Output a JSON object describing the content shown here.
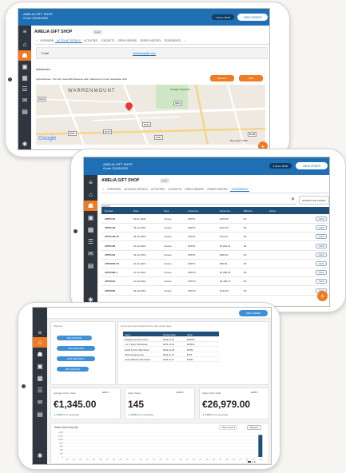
{
  "brand": {
    "orange": "#f07b22",
    "blue": "#1f6fb5",
    "navy": "#2f3640"
  },
  "shop": {
    "name": "AMELIA GIFT SHOP",
    "subtitle": "Order 23/03/2020",
    "badge": "Lost",
    "items_badge": "4 Items / €0.00",
    "view_order": "VIEW ORDER"
  },
  "s1": {
    "tabs": [
      "OVERVIEW",
      "ACCOUNT DETAILS",
      "ACTIVITIES",
      "CONTACTS",
      "OPEN ORDERS",
      "ORDER HISTORY",
      "STATEMENTS"
    ],
    "email_label": "E-Mail",
    "email_value": "ameliashop@ie.com",
    "addresses_label": "Addresses",
    "address": "Aghnaclifnane, The Hill, Greenhills Business park, Newtown Inn road, Stepaside, D/W",
    "btn_select": "SELECT",
    "btn_add": "ADD",
    "map": {
      "area": "WARRENMOUNT",
      "park": "Iveagh Gardens",
      "roads": [
        "R110",
        "R811",
        "R137",
        "R114",
        "R111",
        "R111",
        "R138"
      ],
      "google": "Google",
      "credit": "Map data ©2020"
    }
  },
  "s2": {
    "tabs": [
      "OVERVIEW",
      "ACCOUNT DETAILS",
      "ACTIVITIES",
      "CONTACTS",
      "OPEN ORDERS",
      "ORDER HISTORY",
      "STATEMENTS"
    ],
    "search_placeholder": "Search",
    "download": "DOWNLOAD LATEST",
    "columns": [
      "Number",
      "Date",
      "Type",
      "Customer...",
      "Gross Am...",
      "Balance",
      "Action"
    ],
    "rows": [
      [
        "APPX161",
        "20-01-2020",
        "Invoice",
        "APPX1",
        "€158.05",
        "€0"
      ],
      [
        "APPX148",
        "18-12-2019",
        "Invoice",
        "APPX1",
        "€122.70",
        "€0"
      ],
      [
        "APPX148-18",
        "18-12-2019",
        "Invoice",
        "APPX1",
        "€111.61",
        "€0"
      ],
      [
        "APPX136",
        "13-12-2019",
        "Invoice",
        "APPX1",
        "€3,861.44",
        "€0"
      ],
      [
        "APPX118",
        "02-12-2019",
        "Invoice",
        "APPX1",
        "€282.61",
        "€0"
      ],
      [
        "APPX876-T6",
        "19-11-2019",
        "Invoice",
        "APPX1",
        "€58.93",
        "€0"
      ],
      [
        "APPX098-1",
        "07-11-2019",
        "Invoice",
        "APPX4",
        "€1,096.60",
        "€0"
      ],
      [
        "APPX944",
        "10-10-2019",
        "Invoice",
        "APPX4",
        "€1,456.70",
        "€0"
      ],
      [
        "APPX830",
        "04-10-2019",
        "Invoice",
        "APPX4",
        "€132.03",
        "€0"
      ]
    ],
    "view": "VIEW"
  },
  "s3": {
    "new_order": "NEW ORDER",
    "payment_label": "Payment",
    "payment_buttons": [
      "30% (€27100)",
      "60% (€6723%)",
      "60% (€15100%)",
      "90% (€23216)"
    ],
    "opp_label": "Upcoming opportunities for the next seven days",
    "opp_columns": [
      "Name",
      "Closing Date",
      "Value"
    ],
    "opp_rows": [
      [
        "Bridgestone Electronics",
        "2019-11-30",
        "€65000"
      ],
      [
        "J & F Taylor Wholesale",
        "2019-11-30",
        "€44000"
      ],
      [
        "Smith & Sons Merchants",
        "2019-11-28",
        "€3750"
      ],
      [
        "Welch Engineering",
        "2019-11-27",
        "€375"
      ],
      [
        "Jones Builders Merchants",
        "2019-11-27",
        "€1254"
      ]
    ],
    "kpis": [
      {
        "label": "Average Order Value",
        "currency": "EUR",
        "value": "€1,345.00",
        "delta": "▲ 100%",
        "delta_text": "from yesterday"
      },
      {
        "label": "Sales Today",
        "currency": "EUR",
        "value": "145",
        "delta": "▲ 100%",
        "delta_text": "from yesterday"
      },
      {
        "label": "Sales Order Total",
        "currency": "EUR",
        "value": "€26,979.00",
        "delta": "▲ 100%",
        "delta_text": "from yesterday"
      }
    ],
    "chart_title": "Sales Orders By Day",
    "period": "This month",
    "reload": "Reload"
  },
  "chart_data": {
    "type": "bar",
    "title": "Sales Orders By Day",
    "categories": [
      "01",
      "02",
      "03",
      "04",
      "05",
      "06",
      "07",
      "08",
      "09",
      "10",
      "11",
      "12",
      "13",
      "14",
      "15",
      "16",
      "17",
      "18",
      "19",
      "20",
      "21",
      "22",
      "23",
      "24",
      "25",
      "26",
      "27",
      "28",
      "29",
      "30"
    ],
    "values": [
      0,
      0,
      0,
      0,
      0,
      0,
      0,
      0,
      0,
      0,
      0,
      0,
      0,
      0,
      0,
      0,
      0,
      0,
      0,
      0,
      0,
      0,
      0,
      0,
      0,
      0,
      0,
      0,
      0,
      1250
    ],
    "y_ticks": [
      "0",
      "200",
      "400",
      "600",
      "800",
      "1000",
      "1200",
      "1400"
    ],
    "ylim": [
      0,
      1400
    ],
    "legend": "EUR"
  }
}
